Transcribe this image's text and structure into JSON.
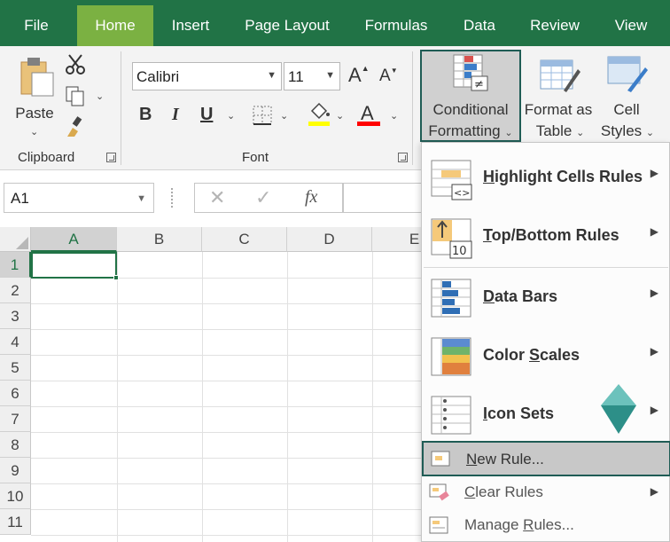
{
  "tabs": [
    {
      "label": "File",
      "active": false
    },
    {
      "label": "Home",
      "active": true
    },
    {
      "label": "Insert",
      "active": false
    },
    {
      "label": "Page Layout",
      "active": false
    },
    {
      "label": "Formulas",
      "active": false
    },
    {
      "label": "Data",
      "active": false
    },
    {
      "label": "Review",
      "active": false
    },
    {
      "label": "View",
      "active": false
    }
  ],
  "ribbon": {
    "clipboard": {
      "paste_label": "Paste",
      "group_label": "Clipboard"
    },
    "font": {
      "name": "Calibri",
      "size": "11",
      "grow_label": "A",
      "shrink_label": "A",
      "bold_label": "B",
      "italic_label": "I",
      "underline_label": "U",
      "font_color_label": "A",
      "fill_color": "#ffff00",
      "font_color": "#ff0000",
      "group_label": "Font"
    },
    "styles": {
      "conditional_formatting_line1": "Conditional",
      "conditional_formatting_line2": "Formatting",
      "format_as_table_line1": "Format as",
      "format_as_table_line2": "Table",
      "cell_styles_line1": "Cell",
      "cell_styles_line2": "Styles"
    }
  },
  "formula_bar": {
    "name_box": "A1",
    "fx_label": "fx",
    "cancel_icon": "close-icon",
    "enter_icon": "check-icon"
  },
  "grid": {
    "columns": [
      "A",
      "B",
      "C",
      "D",
      "E"
    ],
    "rows": [
      "1",
      "2",
      "3",
      "4",
      "5",
      "6",
      "7",
      "8",
      "9",
      "10",
      "11"
    ],
    "selected_cell": "A1"
  },
  "menu": {
    "highlight_cells": {
      "prefix": "",
      "underline": "H",
      "rest": "ighlight Cells Rules"
    },
    "top_bottom": {
      "prefix": "",
      "underline": "T",
      "rest": "op/Bottom Rules"
    },
    "data_bars": {
      "prefix": "",
      "underline": "D",
      "rest": "ata Bars"
    },
    "color_scales": {
      "prefix": "Color ",
      "underline": "S",
      "rest": "cales"
    },
    "icon_sets": {
      "prefix": "",
      "underline": "I",
      "rest": "con Sets"
    },
    "new_rule": {
      "prefix": "",
      "underline": "N",
      "rest": "ew Rule..."
    },
    "clear_rules": {
      "prefix": "",
      "underline": "C",
      "rest": "lear Rules"
    },
    "manage_rules": {
      "prefix": "Manage ",
      "underline": "R",
      "rest": "ules..."
    },
    "icon_top_bottom_text": "10",
    "accent_color": "#1f5c55",
    "arrow_color": "#3a9a94"
  },
  "colors": {
    "excel_green": "#217346",
    "home_tab": "#7bb142"
  }
}
